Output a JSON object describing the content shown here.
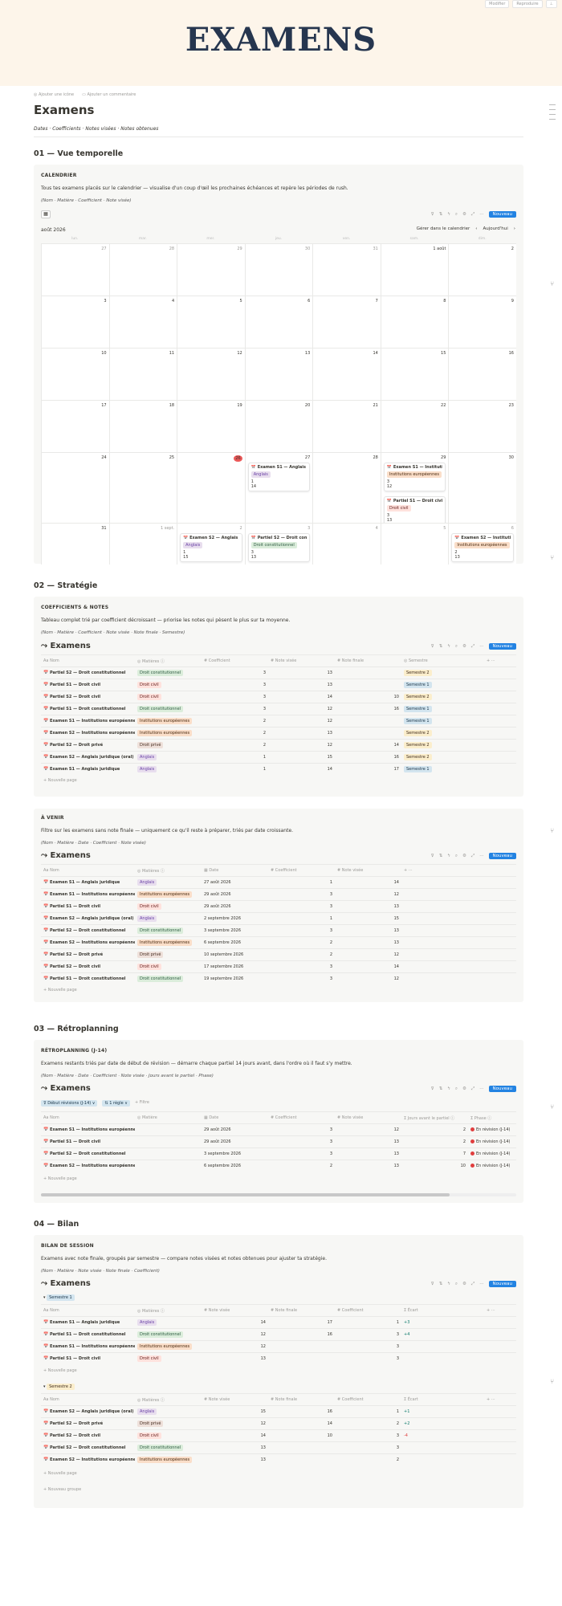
{
  "topbar": {
    "edit": "Modifier",
    "reproduce": "Reproduire",
    "person": "⊥"
  },
  "hero_title": "EXAMENS",
  "actions": {
    "icon": "◎ Ajouter une icône",
    "comment": "▭ Ajouter un commentaire"
  },
  "page_title": "Examens",
  "page_subtitle": "Dates · Coefficients · Notes visées · Notes obtenues",
  "sections": {
    "s1": "01 — Vue temporelle",
    "s2": "02 — Stratégie",
    "s3": "03 — Rétroplanning",
    "s4": "04 — Bilan"
  },
  "calendar": {
    "heading": "CALENDRIER",
    "desc": "Tous tes examens placés sur le calendrier — visualise d'un coup d'œil les prochaines échéances et repère les périodes de rush.",
    "note": "(Nom · Matière · Coefficient · Note visée)",
    "month": "août 2026",
    "manage": "Gérer dans le calendrier",
    "today": "Aujourd'hui",
    "new": "Nouveau",
    "weekdays": [
      "lun.",
      "mar.",
      "mer.",
      "jeu.",
      "ven.",
      "sam.",
      "dim."
    ],
    "weeks": [
      [
        "27",
        "28",
        "29",
        "30",
        "31",
        "1 août",
        "2"
      ],
      [
        "3",
        "4",
        "5",
        "6",
        "7",
        "8",
        "9"
      ],
      [
        "10",
        "11",
        "12",
        "13",
        "14",
        "15",
        "16"
      ],
      [
        "17",
        "18",
        "19",
        "20",
        "21",
        "22",
        "23"
      ],
      [
        "24",
        "25",
        "26",
        "27",
        "28",
        "29",
        "30"
      ],
      [
        "31",
        "1 sept.",
        "2",
        "3",
        "4",
        "5",
        "6"
      ]
    ],
    "events": [
      {
        "title": "Examen S1 — Anglais jur...",
        "tag": "Anglais",
        "cls": "pa",
        "l1": "1",
        "l2": "14"
      },
      {
        "title": "Examen S1 — Institution...",
        "tag": "Institutions européennes",
        "cls": "pe",
        "l1": "3",
        "l2": "12"
      },
      {
        "title": "Partiel S1 — Droit civil",
        "tag": "Droit civil",
        "cls": "pv",
        "l1": "3",
        "l2": "13"
      },
      {
        "title": "Examen S2 — Anglais ju...",
        "tag": "Anglais",
        "cls": "pa",
        "l1": "1",
        "l2": "15"
      },
      {
        "title": "Partiel S2 — Droit const...",
        "tag": "Droit constitutionnel",
        "cls": "pc",
        "l1": "3",
        "l2": "13"
      },
      {
        "title": "Examen S2 — Institutio...",
        "tag": "Institutions européennes",
        "cls": "pe",
        "l1": "2",
        "l2": "13"
      }
    ]
  },
  "coef": {
    "heading": "COEFFICIENTS & NOTES",
    "desc": "Tableau complet trié par coefficient décroissant — priorise les notes qui pèsent le plus sur ta moyenne.",
    "note": "(Nom · Matière · Coefficient · Note visée · Note finale · Semestre)",
    "db": "Examens",
    "new": "Nouveau",
    "cols": [
      "Aa Nom",
      "◎ Matières ⓘ",
      "# Coefficient",
      "# Note visée",
      "# Note finale",
      "◎ Semestre",
      "+ ···"
    ],
    "rows": [
      [
        "Partiel S2 — Droit constitutionnel",
        "Droit constitutionnel",
        "pc",
        "3",
        "13",
        "",
        "Semestre 2",
        "s2"
      ],
      [
        "Partiel S1 — Droit civil",
        "Droit civil",
        "pv",
        "3",
        "13",
        "",
        "Semestre 1",
        "s1"
      ],
      [
        "Partiel S2 — Droit civil",
        "Droit civil",
        "pv",
        "3",
        "14",
        "10",
        "Semestre 2",
        "s2"
      ],
      [
        "Partiel S1 — Droit constitutionnel",
        "Droit constitutionnel",
        "pc",
        "3",
        "12",
        "16",
        "Semestre 1",
        "s1"
      ],
      [
        "Examen S1 — Institutions européennes",
        "Institutions européennes",
        "pe",
        "2",
        "12",
        "",
        "Semestre 1",
        "s1"
      ],
      [
        "Examen S2 — Institutions européennes",
        "Institutions européennes",
        "pe",
        "2",
        "13",
        "",
        "Semestre 2",
        "s2"
      ],
      [
        "Partiel S2 — Droit privé",
        "Droit privé",
        "pp",
        "2",
        "12",
        "14",
        "Semestre 2",
        "s2"
      ],
      [
        "Examen S2 — Anglais juridique (oral)",
        "Anglais",
        "pa",
        "1",
        "15",
        "16",
        "Semestre 2",
        "s2"
      ],
      [
        "Examen S1 — Anglais juridique",
        "Anglais",
        "pa",
        "1",
        "14",
        "17",
        "Semestre 1",
        "s1"
      ]
    ],
    "np": "+ Nouvelle page"
  },
  "avenir": {
    "heading": "À VENIR",
    "desc": "Filtre sur les examens sans note finale — uniquement ce qu'il reste à préparer, triés par date croissante.",
    "note": "(Nom · Matière · Date · Coefficient · Note visée)",
    "db": "Examens",
    "new": "Nouveau",
    "cols": [
      "Aa Nom",
      "◎ Matières ⓘ",
      "▦ Date",
      "# Coefficient",
      "# Note visée",
      "+ ···"
    ],
    "rows": [
      [
        "Examen S1 — Anglais juridique",
        "Anglais",
        "pa",
        "27 août 2026",
        "1",
        "14"
      ],
      [
        "Examen S1 — Institutions européennes",
        "Institutions européennes",
        "pe",
        "29 août 2026",
        "3",
        "12"
      ],
      [
        "Partiel S1 — Droit civil",
        "Droit civil",
        "pv",
        "29 août 2026",
        "3",
        "13"
      ],
      [
        "Examen S2 — Anglais juridique (oral)",
        "Anglais",
        "pa",
        "2 septembre 2026",
        "1",
        "15"
      ],
      [
        "Partiel S2 — Droit constitutionnel",
        "Droit constitutionnel",
        "pc",
        "3 septembre 2026",
        "3",
        "13"
      ],
      [
        "Examen S2 — Institutions européennes",
        "Institutions européennes",
        "pe",
        "6 septembre 2026",
        "2",
        "13"
      ],
      [
        "Partiel S2 — Droit privé",
        "Droit privé",
        "pp",
        "10 septembre 2026",
        "2",
        "12"
      ],
      [
        "Partiel S2 — Droit civil",
        "Droit civil",
        "pv",
        "17 septembre 2026",
        "3",
        "14"
      ],
      [
        "Partiel S1 — Droit constitutionnel",
        "Droit constitutionnel",
        "pc",
        "19 septembre 2026",
        "3",
        "12"
      ]
    ],
    "np": "+ Nouvelle page"
  },
  "retro": {
    "heading": "RÉTROPLANNING (J-14)",
    "desc": "Examens restants triés par date de début de révision — démarre chaque partiel 14 jours avant, dans l'ordre où il faut s'y mettre.",
    "note": "(Nom · Matière · Date · Coefficient · Note visée · Jours avant le partiel · Phase)",
    "db": "Examens",
    "new": "Nouveau",
    "filters": [
      "⊽ Début révisions (J-14) ∨",
      "⇅ 1 règle ∨",
      "+ Filtre"
    ],
    "cols": [
      "Aa Nom",
      "◎ Matière",
      "▦ Date",
      "# Coefficient",
      "# Note visée",
      "Σ Jours avant le partiel ⓘ",
      "Σ Phase ⓘ"
    ],
    "rows": [
      [
        "Examen S1 — Institutions européennes",
        "29 août 2026",
        "3",
        "12",
        "2",
        "En révision (J-14)"
      ],
      [
        "Partiel S1 — Droit civil",
        "29 août 2026",
        "3",
        "13",
        "2",
        "En révision (J-14)"
      ],
      [
        "Partiel S2 — Droit constitutionnel",
        "3 septembre 2026",
        "3",
        "13",
        "7",
        "En révision (J-14)"
      ],
      [
        "Examen S2 — Institutions européennes",
        "6 septembre 2026",
        "2",
        "13",
        "10",
        "En révision (J-14)"
      ]
    ],
    "np": "+ Nouvelle page"
  },
  "bilan": {
    "heading": "BILAN DE SESSION",
    "desc": "Examens avec note finale, groupés par semestre — compare notes visées et notes obtenues pour ajuster ta stratégie.",
    "note": "(Nom · Matière · Note visée · Note finale · Coefficient)",
    "db": "Examens",
    "new": "Nouveau",
    "cols": [
      "Aa Nom",
      "◎ Matières ⓘ",
      "# Note visée",
      "# Note finale",
      "# Coefficient",
      "Σ Écart",
      "+ ···"
    ],
    "g1": "Semestre 1",
    "g2": "Semestre 2",
    "rows1": [
      [
        "Examen S1 — Anglais juridique",
        "Anglais",
        "pa",
        "14",
        "17",
        "1",
        "+3"
      ],
      [
        "Partiel S1 — Droit constitutionnel",
        "Droit constitutionnel",
        "pc",
        "12",
        "16",
        "3",
        "+4"
      ],
      [
        "Examen S1 — Institutions européennes",
        "Institutions européennes",
        "pe",
        "12",
        "",
        "3",
        ""
      ],
      [
        "Partiel S1 — Droit civil",
        "Droit civil",
        "pv",
        "13",
        "",
        "3",
        ""
      ]
    ],
    "rows2": [
      [
        "Examen S2 — Anglais juridique (oral)",
        "Anglais",
        "pa",
        "15",
        "16",
        "1",
        "+1"
      ],
      [
        "Partiel S2 — Droit privé",
        "Droit privé",
        "pp",
        "12",
        "14",
        "2",
        "+2"
      ],
      [
        "Partiel S2 — Droit civil",
        "Droit civil",
        "pv",
        "14",
        "10",
        "3",
        "-4"
      ],
      [
        "Partiel S2 — Droit constitutionnel",
        "Droit constitutionnel",
        "pc",
        "13",
        "",
        "3",
        ""
      ],
      [
        "Examen S2 — Institutions européennes",
        "Institutions européennes",
        "pe",
        "13",
        "",
        "2",
        ""
      ]
    ],
    "np": "+ Nouvelle page",
    "ng": "+ Nouveau groupe"
  },
  "colors": {
    "accent": "#2383e2",
    "hero_bg": "#fdf5ea",
    "card_bg": "#f7f7f5",
    "title": "#26364f"
  }
}
